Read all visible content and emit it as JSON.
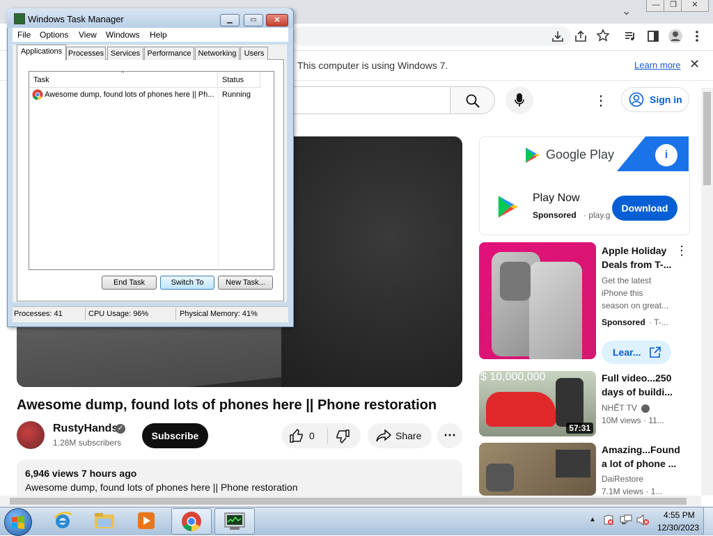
{
  "browser": {
    "window_buttons": {
      "minimize": "—",
      "restore": "❐",
      "close": "✕"
    },
    "tab_dropdown": "⌄",
    "toolbar_icons": [
      "download-icon",
      "share-icon",
      "star-icon",
      "media-icon",
      "sidepanel-icon",
      "profile-icon",
      "menu-icon"
    ],
    "infobar": {
      "text": "This computer is using Windows 7.",
      "link": "Learn more",
      "close": "✕"
    }
  },
  "youtube": {
    "header": {
      "menu_dots": "⋮",
      "signin_label": "Sign in"
    },
    "video": {
      "title": "Awesome dump, found lots of phones here || Phone restoration",
      "channel": "RustyHands",
      "verified": "✓",
      "subscribers": "1.28M subscribers",
      "subscribe_label": "Subscribe",
      "likes": "0",
      "share_label": "Share",
      "more": "⋯",
      "views_time": "6,946 views  7 hours ago",
      "description": "Awesome dump, found lots of phones here || Phone restoration"
    },
    "ad": {
      "brand": "Google Play",
      "info": "i",
      "title": "Play Now",
      "sponsored": "Sponsored",
      "domain": "· play.g",
      "download_label": "Download"
    },
    "apple_ad": {
      "title": "Apple Holiday Deals from T-...",
      "menu": "⋮",
      "description": "Get the latest iPhone this season on great...",
      "sponsored": "Sponsored",
      "domain": "· T-...",
      "learn_label": "Lear..."
    },
    "recommendations": [
      {
        "title": "Full video...250 days of buildi...",
        "channel": "NHẾT TV",
        "meta": "10M views  · 11...",
        "duration": "57:31",
        "overlay": "$ 10,000,000"
      },
      {
        "title": "Amazing...Found a lot of phone ...",
        "channel": "DaiRestore",
        "meta": "7.1M views  · 1..."
      }
    ]
  },
  "task_manager": {
    "title": "Windows Task Manager",
    "controls": {
      "minimize": "▁",
      "maximize": "▭",
      "close": "✕"
    },
    "menus": [
      "File",
      "Options",
      "View",
      "Windows",
      "Help"
    ],
    "tabs": [
      "Applications",
      "Processes",
      "Services",
      "Performance",
      "Networking",
      "Users"
    ],
    "columns": {
      "task": "Task",
      "status": "Status"
    },
    "rows": [
      {
        "task": "Awesome dump, found lots of phones here || Ph...",
        "status": "Running"
      }
    ],
    "buttons": {
      "end_task": "End Task",
      "switch_to": "Switch To",
      "new_task": "New Task..."
    },
    "status": {
      "processes": "Processes: 41",
      "cpu": "CPU Usage: 96%",
      "memory": "Physical Memory: 41%"
    }
  },
  "taskbar": {
    "apps": [
      "ie-icon",
      "explorer-icon",
      "media-player-icon",
      "chrome-icon",
      "task-manager-icon"
    ],
    "time": "4:55 PM",
    "date": "12/30/2023"
  },
  "colors": {
    "youtube_blue": "#065fd4",
    "windows_taskbar": "#aac2dc",
    "tm_frame": "#c9dcee"
  }
}
